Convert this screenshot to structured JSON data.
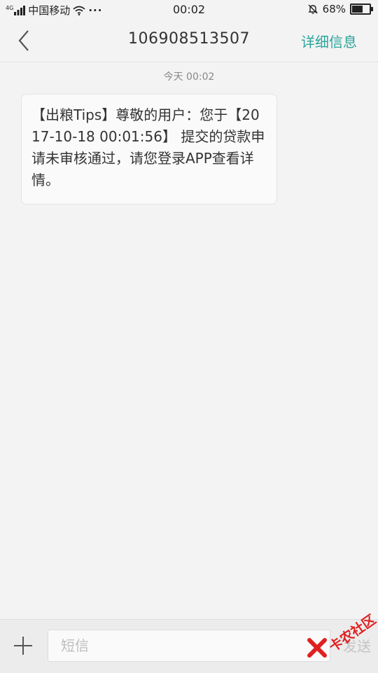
{
  "status_bar": {
    "network": "4G",
    "carrier": "中国移动",
    "dots": "···",
    "time": "00:02",
    "battery_percent": "68%",
    "battery_level": 0.68
  },
  "header": {
    "title": "106908513507",
    "details_label": "详细信息"
  },
  "conversation": {
    "date_stamp": "今天  00:02",
    "messages": [
      {
        "text": "【出粮Tips】尊敬的用户：您于【2017-10-18 00:01:56】 提交的贷款申请未审核通过，请您登录APP查看详情。"
      }
    ]
  },
  "input_bar": {
    "placeholder": "短信",
    "send_label": "发送"
  },
  "watermark": {
    "text": "卡农社区"
  },
  "colors": {
    "accent": "#2aa59b",
    "background": "#f3f3f3",
    "watermark": "#e02020"
  },
  "icons": [
    "signal-icon",
    "wifi-icon",
    "mute-bell-icon",
    "battery-icon",
    "back-chevron-icon",
    "plus-icon"
  ]
}
